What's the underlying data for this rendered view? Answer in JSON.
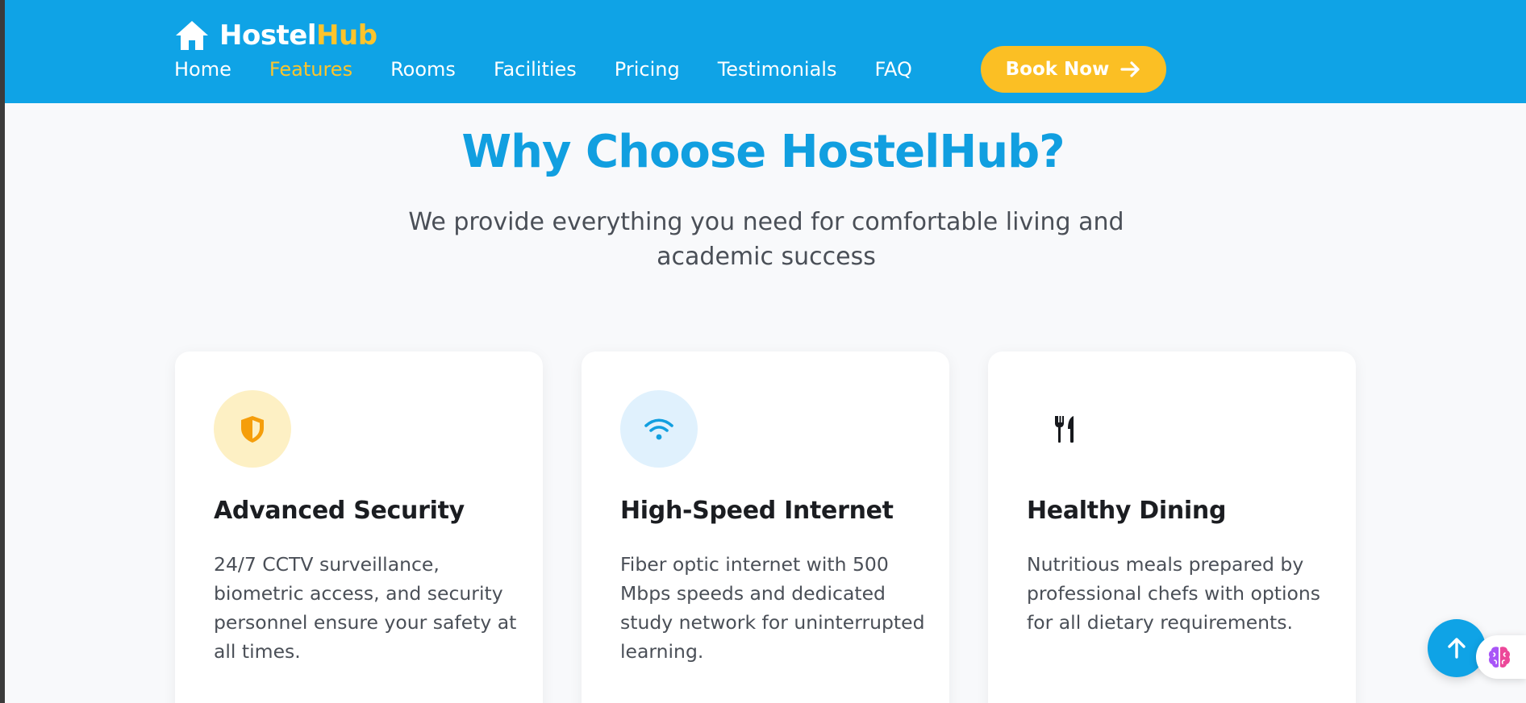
{
  "header": {
    "logo_part1": "Hostel",
    "logo_part2": "Hub",
    "nav": [
      {
        "label": "Home",
        "active": false
      },
      {
        "label": "Features",
        "active": true
      },
      {
        "label": "Rooms",
        "active": false
      },
      {
        "label": "Facilities",
        "active": false
      },
      {
        "label": "Pricing",
        "active": false
      },
      {
        "label": "Testimonials",
        "active": false
      },
      {
        "label": "FAQ",
        "active": false
      }
    ],
    "book_label": "Book Now"
  },
  "section": {
    "title": "Why Choose HostelHub?",
    "subtitle": "We provide everything you need for comfortable living and academic success"
  },
  "features": [
    {
      "icon": "shield-icon",
      "title": "Advanced Security",
      "desc": "24/7 CCTV surveillance, biometric access, and security personnel ensure your safety at all times."
    },
    {
      "icon": "wifi-icon",
      "title": "High-Speed Internet",
      "desc": "Fiber optic internet with 500 Mbps speeds and dedicated study network for uninterrupted learning."
    },
    {
      "icon": "utensils-icon",
      "title": "Healthy Dining",
      "desc": "Nutritious meals prepared by professional chefs with options for all dietary requirements."
    }
  ],
  "colors": {
    "brand": "#0fa3e6",
    "accent": "#fcc42c",
    "text_dark": "#1b1d21",
    "text_muted": "#4a4f57"
  }
}
